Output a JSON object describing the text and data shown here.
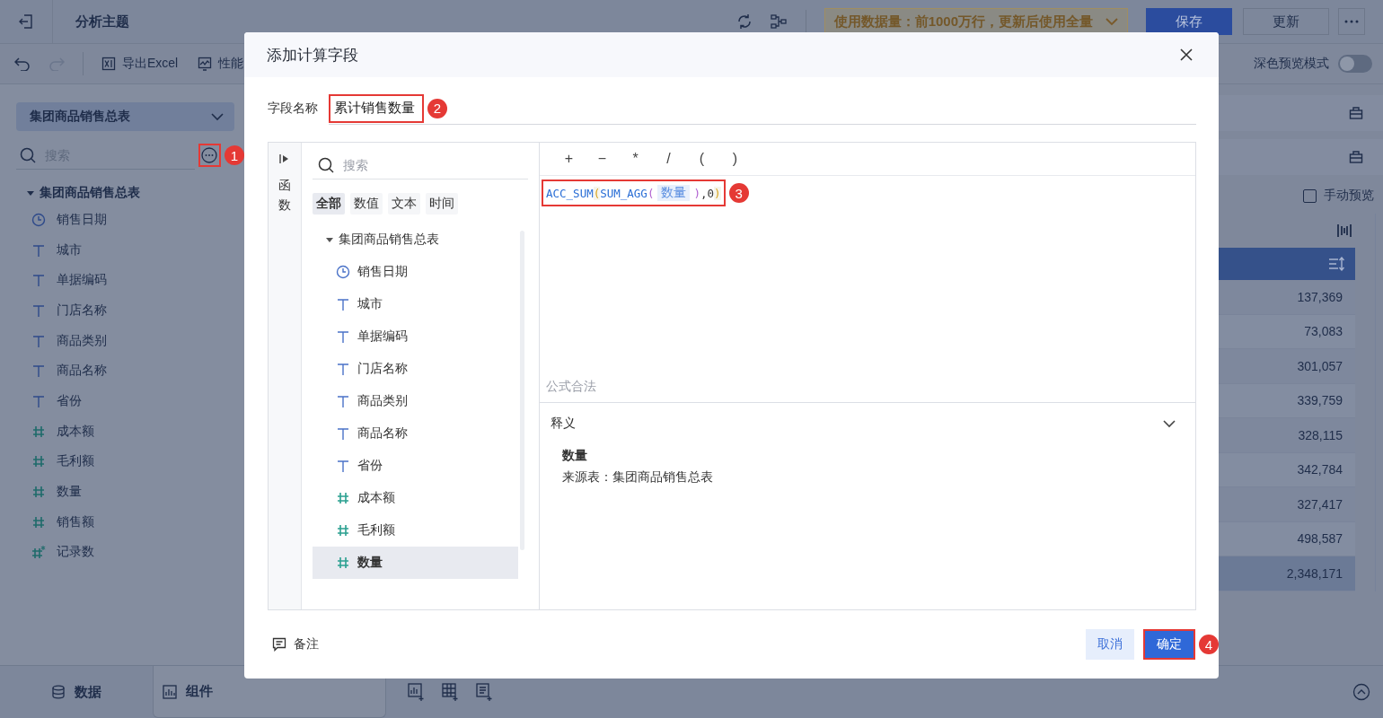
{
  "topbar": {
    "title": "分析主题",
    "data_mode": "使用数据量：前1000万行，更新后使用全量",
    "buttons": [
      {
        "label": "保存",
        "kind": "primary"
      },
      {
        "label": "更新",
        "kind": "default"
      }
    ]
  },
  "toolbar": {
    "items": [
      {
        "label": "导出Excel",
        "kind": "excel"
      },
      {
        "label": "性能",
        "kind": "performance"
      }
    ],
    "dark_mode": {
      "label": "深色预览模式",
      "on": false
    }
  },
  "sidebar": {
    "dataset": "集团商品销售总表",
    "search": {
      "placeholder": "搜索"
    },
    "more_callout": "1",
    "tree": {
      "label": "集团商品销售总表",
      "expanded": true,
      "children": [
        {
          "label": "销售日期",
          "kind": "date"
        },
        {
          "label": "城市",
          "kind": "text"
        },
        {
          "label": "单据编码",
          "kind": "text"
        },
        {
          "label": "门店名称",
          "kind": "text"
        },
        {
          "label": "商品类别",
          "kind": "text"
        },
        {
          "label": "商品名称",
          "kind": "text"
        },
        {
          "label": "省份",
          "kind": "text"
        },
        {
          "label": "成本额",
          "kind": "number"
        },
        {
          "label": "毛利额",
          "kind": "number"
        },
        {
          "label": "数量",
          "kind": "number"
        },
        {
          "label": "销售额",
          "kind": "number"
        },
        {
          "label": "记录数",
          "kind": "count"
        }
      ]
    }
  },
  "preview": {
    "manual_preview": {
      "label": "手动预览",
      "checked": false
    },
    "values": [
      "137,369",
      "73,083",
      "301,057",
      "339,759",
      "328,115",
      "342,784",
      "327,417",
      "498,587"
    ],
    "total": "2,348,171"
  },
  "bottom_tabs": [
    {
      "label": "数据",
      "kind": "data",
      "selected": false
    },
    {
      "label": "组件",
      "kind": "widget",
      "selected": true
    }
  ],
  "dialog": {
    "title": "添加计算字段",
    "field_name": {
      "label": "字段名称",
      "value": "累计销售数量",
      "callout": "2"
    },
    "side_tab": "函数",
    "search": {
      "placeholder": "搜索"
    },
    "filters": [
      {
        "label": "全部",
        "selected": true
      },
      {
        "label": "数值",
        "selected": false
      },
      {
        "label": "文本",
        "selected": false
      },
      {
        "label": "时间",
        "selected": false
      }
    ],
    "tree": {
      "label": "集团商品销售总表",
      "expanded": true,
      "children": [
        {
          "label": "销售日期",
          "kind": "date",
          "selected": false
        },
        {
          "label": "城市",
          "kind": "text",
          "selected": false
        },
        {
          "label": "单据编码",
          "kind": "text",
          "selected": false
        },
        {
          "label": "门店名称",
          "kind": "text",
          "selected": false
        },
        {
          "label": "商品类别",
          "kind": "text",
          "selected": false
        },
        {
          "label": "商品名称",
          "kind": "text",
          "selected": false
        },
        {
          "label": "省份",
          "kind": "text",
          "selected": false
        },
        {
          "label": "成本额",
          "kind": "number",
          "selected": false
        },
        {
          "label": "毛利额",
          "kind": "number",
          "selected": false
        },
        {
          "label": "数量",
          "kind": "number",
          "selected": true
        }
      ]
    },
    "operators": [
      "+",
      "−",
      "*",
      "/",
      "(",
      ")"
    ],
    "formula": {
      "callout": "3",
      "tokens": [
        {
          "text": "ACC_SUM",
          "kind": "func"
        },
        {
          "text": "(",
          "kind": "outer"
        },
        {
          "text": "SUM_AGG",
          "kind": "func"
        },
        {
          "text": "(",
          "kind": "inner"
        },
        {
          "text": "数量",
          "kind": "field"
        },
        {
          "text": ")",
          "kind": "inner"
        },
        {
          "text": ",0",
          "kind": "plain"
        },
        {
          "text": ")",
          "kind": "outer"
        }
      ]
    },
    "status": "公式合法",
    "explain": {
      "label": "释义",
      "expanded": true,
      "field": "数量",
      "source": "来源表：集团商品销售总表"
    },
    "note": "备注",
    "buttons": [
      {
        "label": "取消",
        "kind": "secondary"
      },
      {
        "label": "确定",
        "kind": "primary",
        "callout": "4"
      }
    ]
  }
}
